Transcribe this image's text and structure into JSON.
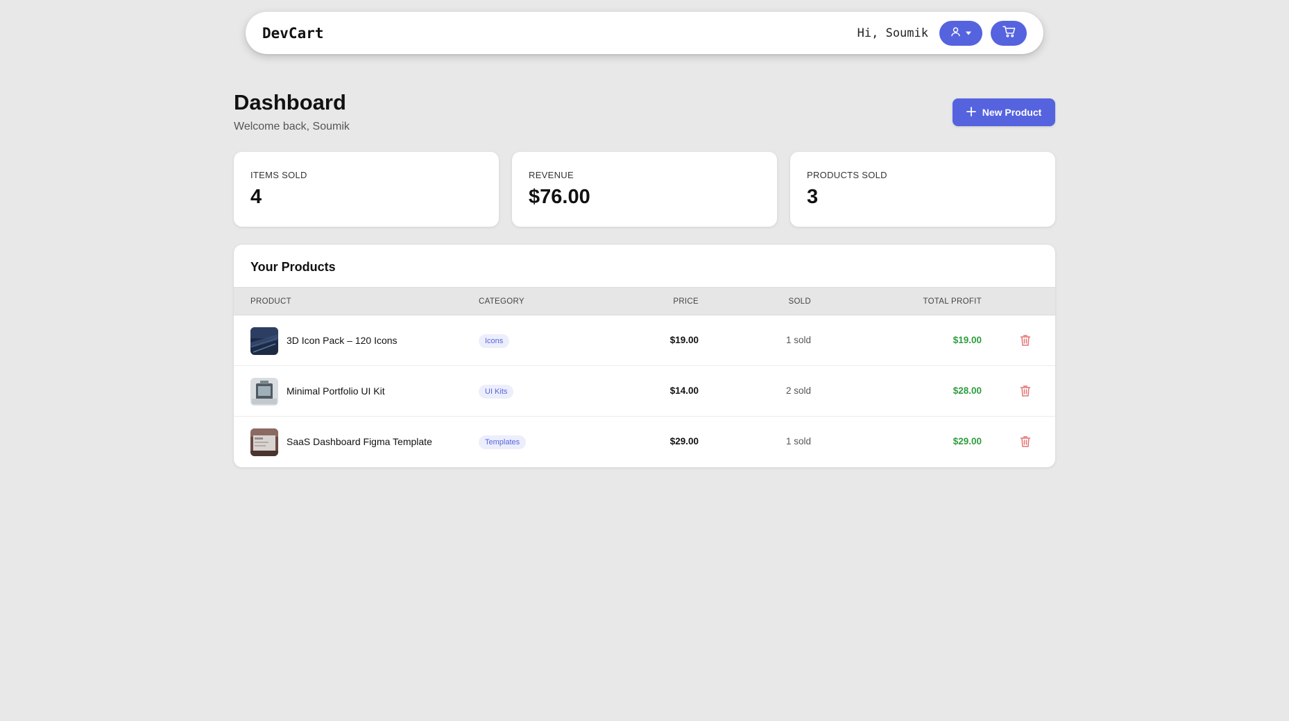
{
  "navbar": {
    "brand": "DevCart",
    "greeting": "Hi, Soumik",
    "user_icon": "user-icon",
    "caret_icon": "caret-down-icon",
    "cart_icon": "cart-icon"
  },
  "header": {
    "title": "Dashboard",
    "subtitle": "Welcome back, Soumik",
    "new_product_label": "New Product",
    "new_product_icon": "plus-icon"
  },
  "stats": [
    {
      "label": "ITEMS SOLD",
      "value": "4"
    },
    {
      "label": "REVENUE",
      "value": "$76.00"
    },
    {
      "label": "PRODUCTS SOLD",
      "value": "3"
    }
  ],
  "products": {
    "title": "Your Products",
    "columns": {
      "product": "PRODUCT",
      "category": "CATEGORY",
      "price": "PRICE",
      "sold": "SOLD",
      "total_profit": "TOTAL PROFIT"
    },
    "rows": [
      {
        "name": "3D Icon Pack – 120 Icons",
        "category": "Icons",
        "price": "$19.00",
        "sold": "1 sold",
        "profit": "$19.00"
      },
      {
        "name": "Minimal Portfolio UI Kit",
        "category": "UI Kits",
        "price": "$14.00",
        "sold": "2 sold",
        "profit": "$28.00"
      },
      {
        "name": "SaaS Dashboard Figma Template",
        "category": "Templates",
        "price": "$29.00",
        "sold": "1 sold",
        "profit": "$29.00"
      }
    ]
  },
  "colors": {
    "accent": "#5563df",
    "profit": "#2e9d3e",
    "delete": "#e57373",
    "background": "#e8e8e9"
  }
}
